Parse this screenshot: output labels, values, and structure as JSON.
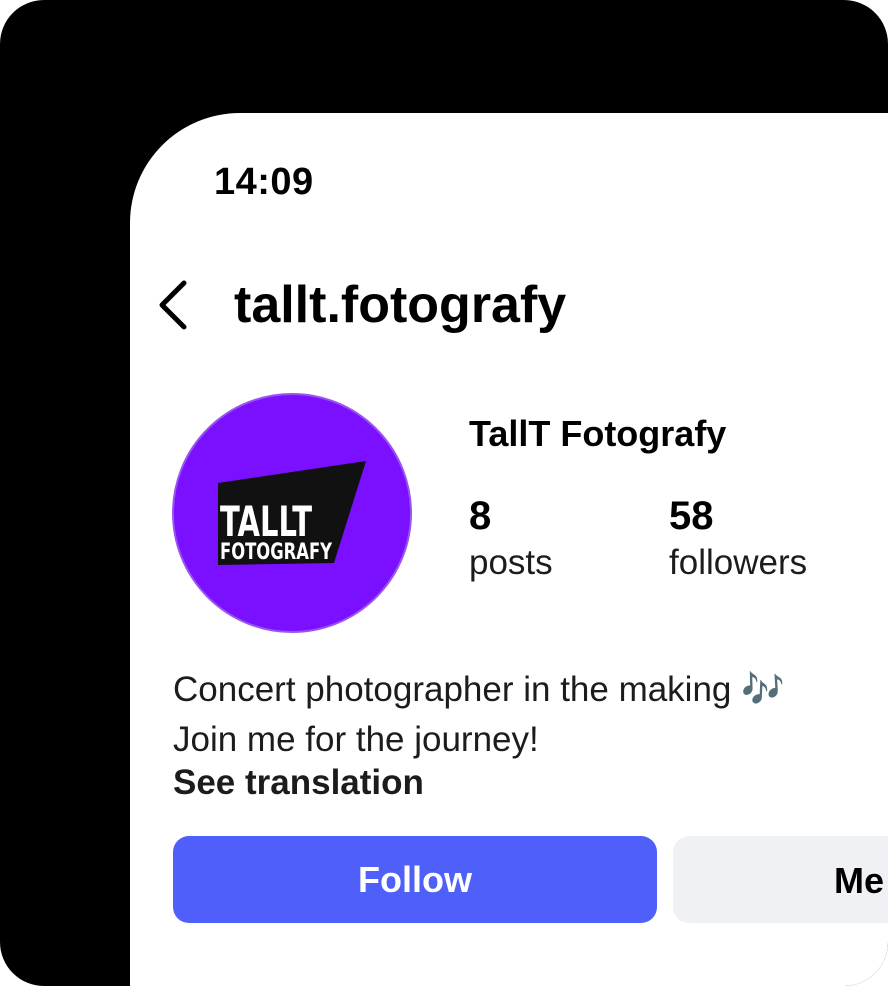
{
  "status_bar": {
    "time": "14:09"
  },
  "header": {
    "back_icon": "chevron-left-icon",
    "username": "tallt.fotografy"
  },
  "profile": {
    "display_name": "TallT Fotografy",
    "avatar": {
      "logo_line1": "TALLT",
      "logo_line2": "FOTOGRAFY"
    },
    "stats": [
      {
        "count": "8",
        "label": "posts"
      },
      {
        "count": "58",
        "label": "followers"
      }
    ],
    "bio_line1": "Concert photographer in the making 🎶",
    "bio_line2": "Join me for the journey!",
    "see_translation": "See translation"
  },
  "actions": {
    "follow_label": "Follow",
    "message_label": "Me"
  },
  "colors": {
    "follow_button": "#4f60fa",
    "avatar_bg": "#7a10ff",
    "message_button": "#eff1f5",
    "logo_banner": "#111111",
    "logo_text": "#ffffff"
  }
}
